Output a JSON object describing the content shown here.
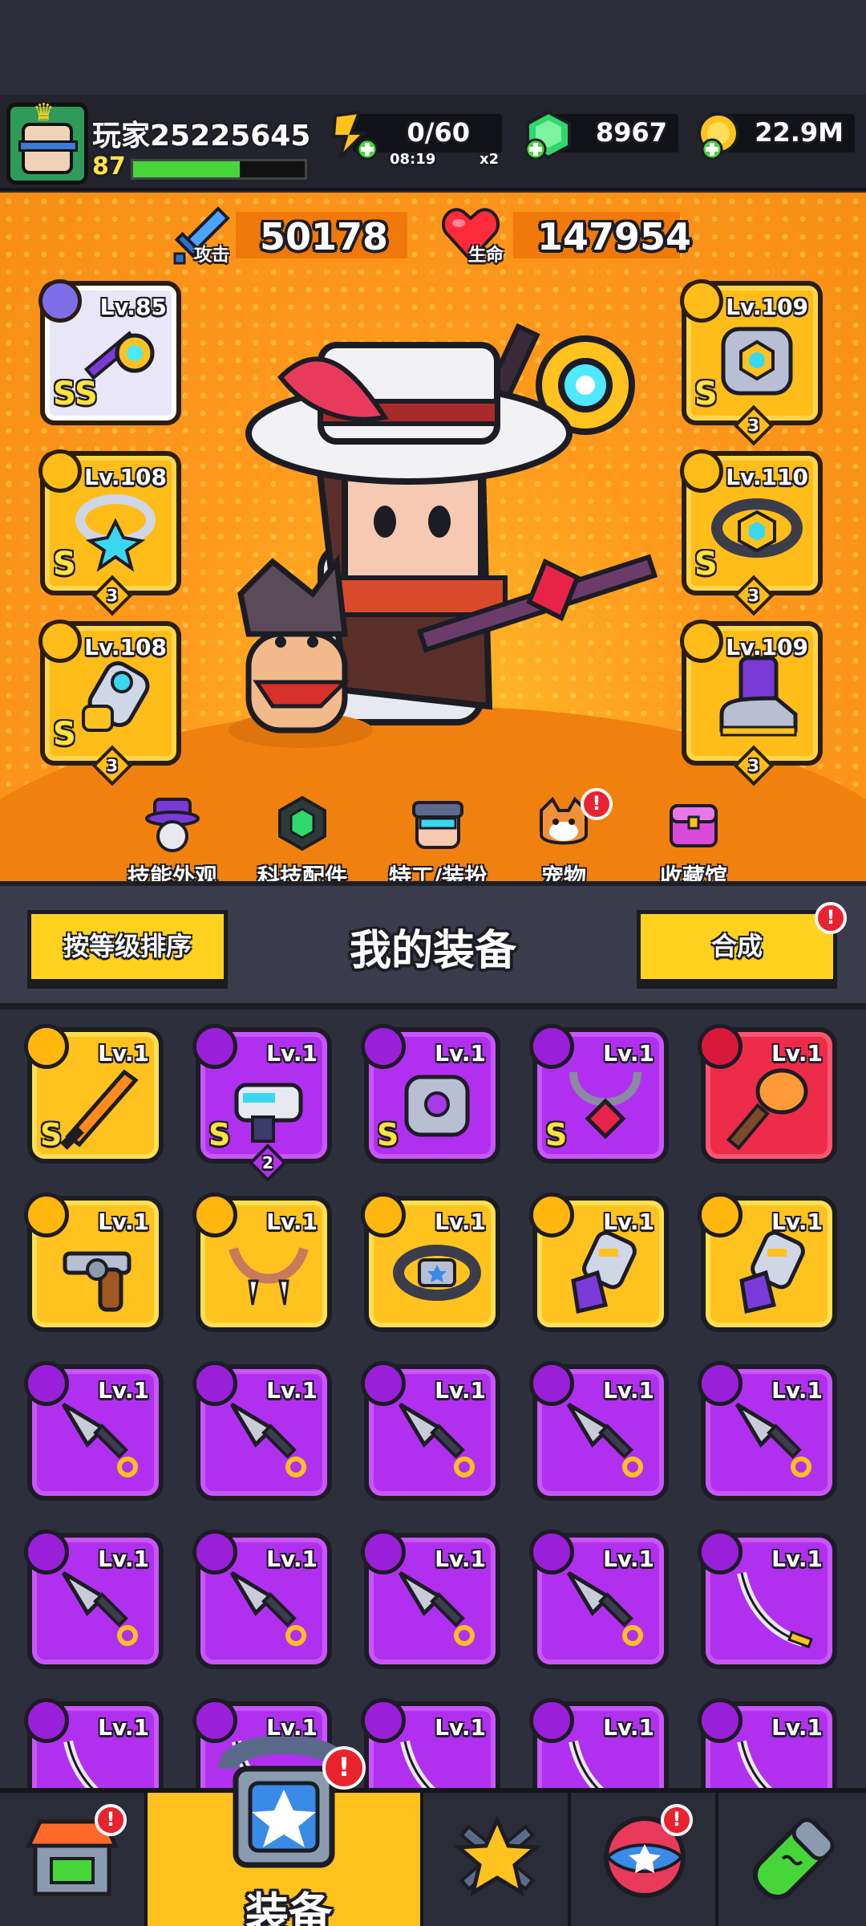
{
  "player": {
    "name": "玩家25225645",
    "level": "87",
    "xp_progress": 0.62
  },
  "resources": {
    "energy": "0/60",
    "energy_timer": "08:19",
    "energy_multiplier": "x2",
    "gems": "8967",
    "gold": "22.9M"
  },
  "hero": {
    "attack_label": "攻击",
    "attack_value": "50178",
    "hp_label": "生命",
    "hp_value": "147954",
    "slots": [
      {
        "name": "weapon",
        "level": "Lv.85",
        "tier": "SS",
        "stars": "",
        "rarity": "white"
      },
      {
        "name": "necklace",
        "level": "Lv.108",
        "tier": "S",
        "stars": "3",
        "rarity": "gold"
      },
      {
        "name": "gloves",
        "level": "Lv.108",
        "tier": "S",
        "stars": "3",
        "rarity": "gold"
      },
      {
        "name": "armor",
        "level": "Lv.109",
        "tier": "S",
        "stars": "3",
        "rarity": "gold"
      },
      {
        "name": "belt",
        "level": "Lv.110",
        "tier": "S",
        "stars": "3",
        "rarity": "gold"
      },
      {
        "name": "boots",
        "level": "Lv.109",
        "tier": "",
        "stars": "3",
        "rarity": "gold"
      }
    ],
    "tabs": [
      {
        "label": "技能外观"
      },
      {
        "label": "科技配件"
      },
      {
        "label": "特工/装扮"
      },
      {
        "label": "宠物",
        "alert": "!"
      },
      {
        "label": "收藏馆"
      }
    ]
  },
  "inventory": {
    "sort_label": "按等级排序",
    "title": "我的装备",
    "merge_label": "合成",
    "merge_alert": "!",
    "rows": [
      [
        {
          "type": "sword",
          "level": "Lv.1",
          "tier": "S",
          "rarity": "gold"
        },
        {
          "type": "blaster",
          "level": "Lv.1",
          "tier": "S",
          "rarity": "purple",
          "stars": "2"
        },
        {
          "type": "armor",
          "level": "Lv.1",
          "tier": "S",
          "rarity": "purple"
        },
        {
          "type": "necklace",
          "level": "Lv.1",
          "tier": "S",
          "rarity": "purple"
        },
        {
          "type": "torch",
          "level": "Lv.1",
          "tier": "",
          "rarity": "red"
        }
      ],
      [
        {
          "type": "revolver",
          "level": "Lv.1",
          "tier": "",
          "rarity": "gold"
        },
        {
          "type": "fang-necklace",
          "level": "Lv.1",
          "tier": "",
          "rarity": "gold"
        },
        {
          "type": "belt",
          "level": "Lv.1",
          "tier": "",
          "rarity": "gold"
        },
        {
          "type": "gauntlet",
          "level": "Lv.1",
          "tier": "",
          "rarity": "gold"
        },
        {
          "type": "gauntlet",
          "level": "Lv.1",
          "tier": "",
          "rarity": "gold"
        }
      ],
      [
        {
          "type": "kunai",
          "level": "Lv.1",
          "tier": "",
          "rarity": "purple"
        },
        {
          "type": "kunai",
          "level": "Lv.1",
          "tier": "",
          "rarity": "purple"
        },
        {
          "type": "kunai",
          "level": "Lv.1",
          "tier": "",
          "rarity": "purple"
        },
        {
          "type": "kunai",
          "level": "Lv.1",
          "tier": "",
          "rarity": "purple"
        },
        {
          "type": "kunai",
          "level": "Lv.1",
          "tier": "",
          "rarity": "purple"
        }
      ],
      [
        {
          "type": "kunai",
          "level": "Lv.1",
          "tier": "",
          "rarity": "purple"
        },
        {
          "type": "kunai",
          "level": "Lv.1",
          "tier": "",
          "rarity": "purple"
        },
        {
          "type": "kunai",
          "level": "Lv.1",
          "tier": "",
          "rarity": "purple"
        },
        {
          "type": "kunai",
          "level": "Lv.1",
          "tier": "",
          "rarity": "purple"
        },
        {
          "type": "katana",
          "level": "Lv.1",
          "tier": "",
          "rarity": "purple"
        }
      ],
      [
        {
          "type": "katana",
          "level": "Lv.1",
          "tier": "",
          "rarity": "purple"
        },
        {
          "type": "katana",
          "level": "Lv.1",
          "tier": "",
          "rarity": "purple"
        },
        {
          "type": "katana",
          "level": "Lv.1",
          "tier": "",
          "rarity": "purple"
        },
        {
          "type": "katana",
          "level": "Lv.1",
          "tier": "",
          "rarity": "purple"
        },
        {
          "type": "katana",
          "level": "Lv.1",
          "tier": "",
          "rarity": "purple"
        }
      ]
    ]
  },
  "bottom_nav": {
    "shop_alert": "!",
    "equip_label": "装备",
    "equip_alert": "!",
    "events_alert": "!"
  },
  "colors": {
    "gold_rarity": "#ffc21e",
    "purple_rarity": "#b130f0",
    "red_rarity": "#ef2b4a",
    "hero_bg": "#f78d15",
    "alert": "#e8232f"
  }
}
